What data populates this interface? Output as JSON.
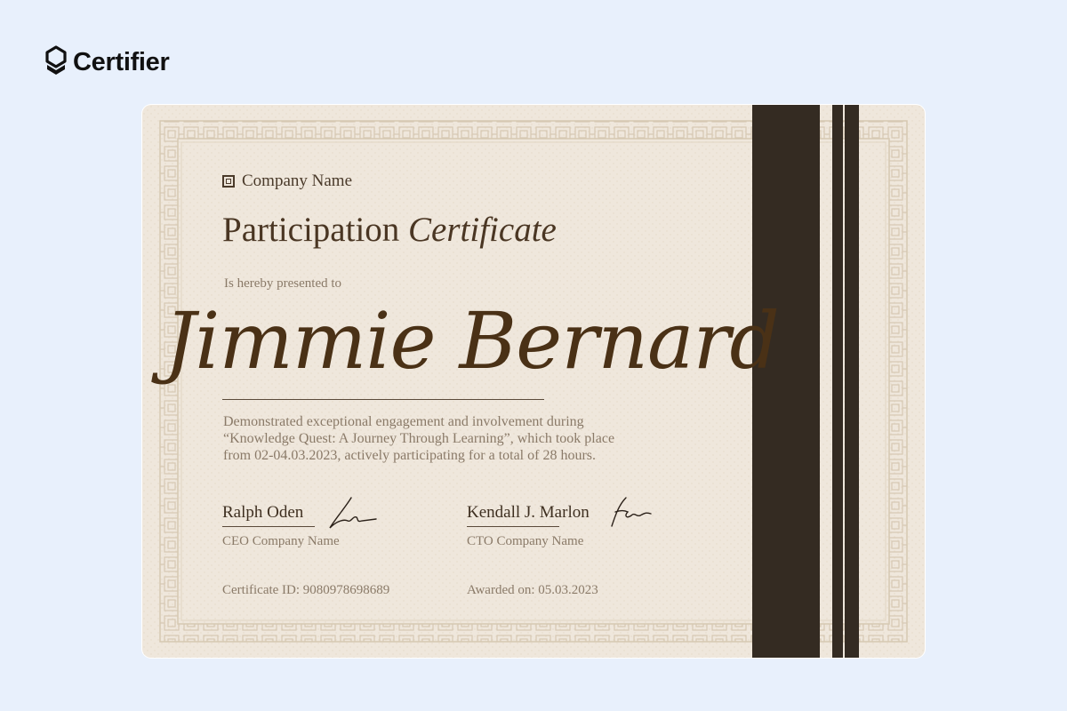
{
  "brand": {
    "name": "Certifier",
    "logo_icon": "certifier-shield-icon"
  },
  "certificate": {
    "company_name": "Company Name",
    "company_icon": "square-logo-icon",
    "title_main": "Participation",
    "title_italic": "Certificate",
    "presented_text": "Is hereby presented to",
    "recipient_name": "Jimmie Bernard",
    "description_lines": [
      "Demonstrated exceptional engagement and involvement during",
      "“Knowledge Quest: A Journey Through Learning”, which took place",
      "from 02-04.03.2023, actively participating for a total of 28 hours."
    ],
    "signatories": [
      {
        "name": "Ralph Oden",
        "role": "CEO Company Name"
      },
      {
        "name": "Kendall J. Marlon",
        "role": "CTO Company Name"
      }
    ],
    "certificate_id": "Certificate ID: 9080978698689",
    "awarded_on": "Awarded on: 05.03.2023"
  },
  "colors": {
    "page_background": "#e8f0fc",
    "paper": "#efe7dc",
    "border_pattern": "#d9ccb8",
    "dark_band": "#342b22",
    "title_text": "#4a3623",
    "muted_text": "#8a7a68"
  }
}
